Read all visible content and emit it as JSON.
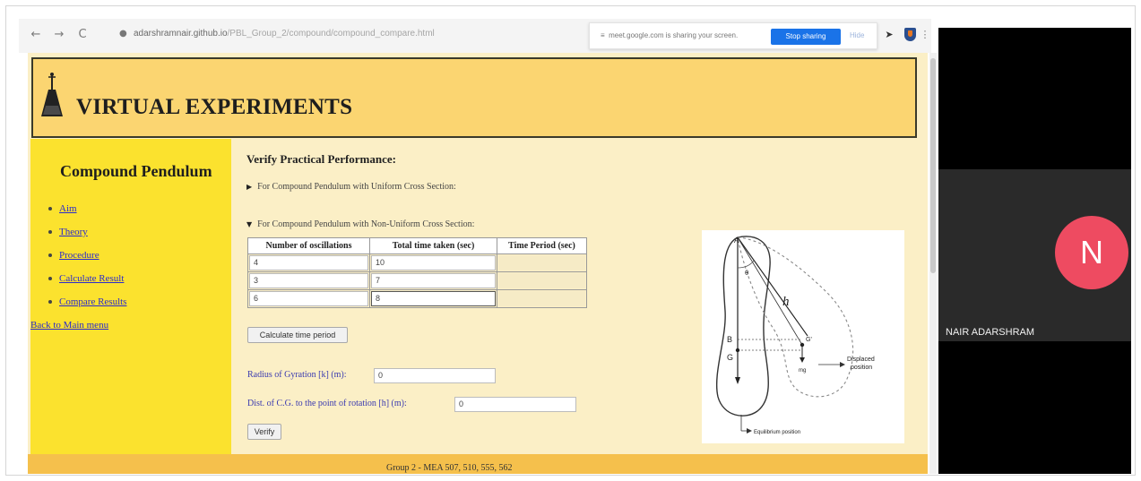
{
  "browser": {
    "url_host": "adarshramnair.github.io",
    "url_path": "/PBL_Group_2/compound/compound_compare.html",
    "nav": {
      "back": "←",
      "forward": "→",
      "reload": "C"
    },
    "share_bar": {
      "message": "meet.google.com is sharing your screen.",
      "stop_label": "Stop sharing",
      "hide_label": "Hide"
    },
    "extension_icons": [
      "puzzle-icon",
      "shield-icon",
      "menu-icon"
    ]
  },
  "site": {
    "title": "VIRTUAL EXPERIMENTS"
  },
  "sidebar": {
    "title": "Compound Pendulum",
    "items": [
      {
        "label": "Aim"
      },
      {
        "label": "Theory"
      },
      {
        "label": "Procedure"
      },
      {
        "label": "Calculate Result"
      },
      {
        "label": "Compare Results"
      }
    ],
    "back_label": "Back to Main menu"
  },
  "main": {
    "heading": "Verify Practical Performance:",
    "uniform_summary": "For Compound Pendulum with Uniform Cross Section:",
    "nonuniform_summary": "For Compound Pendulum with Non-Uniform Cross Section:",
    "table": {
      "headers": [
        "Number of oscillations",
        "Total time taken (sec)",
        "Time Period (sec)"
      ],
      "rows": [
        {
          "oscillations": "4",
          "time": "10",
          "period": ""
        },
        {
          "oscillations": "3",
          "time": "7",
          "period": ""
        },
        {
          "oscillations": "6",
          "time": "8",
          "period": ""
        }
      ]
    },
    "calc_button": "Calculate time period",
    "radius_label": "Radius of Gyration [k] (m):",
    "radius_value": "0",
    "dist_label": "Dist. of C.G. to the point of rotation [h] (m):",
    "dist_value": "0",
    "verify_button": "Verify"
  },
  "diagram": {
    "labels": {
      "a": "A",
      "theta": "θ",
      "h": "h",
      "b": "B",
      "g": "G",
      "g_prime": "G'",
      "mg": "mg",
      "displaced": "Displaced",
      "position": "position",
      "equilibrium": "Equilibrium position"
    }
  },
  "footer": {
    "text": "Group 2 - MEA 507, 510, 555, 562"
  },
  "meet": {
    "avatar_letter": "N",
    "participant_name": "NAIR ADARSHRAM",
    "avatar_color": "#ee4b61"
  }
}
